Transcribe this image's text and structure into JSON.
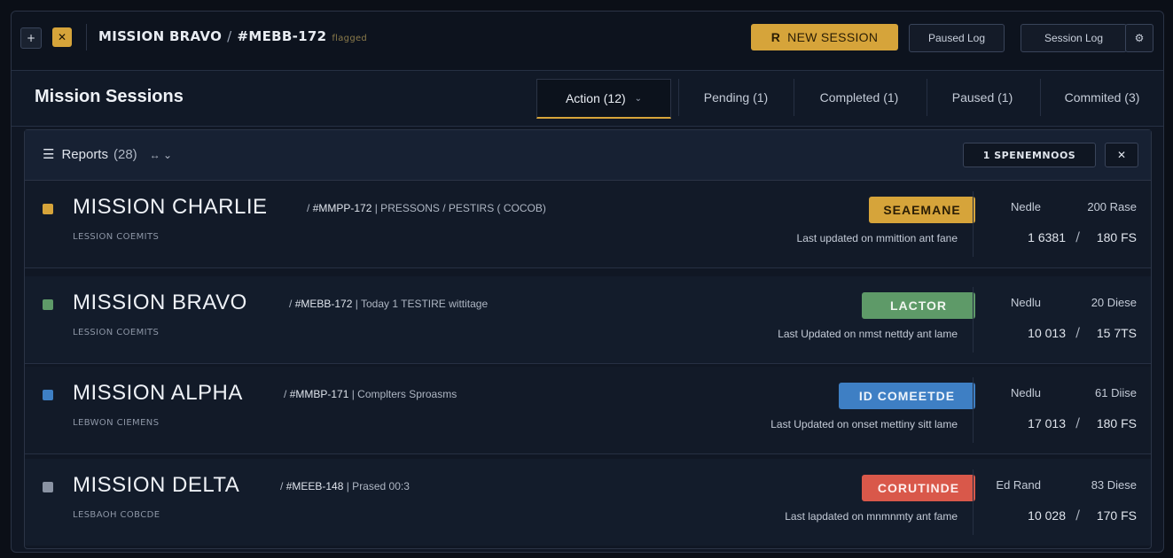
{
  "topbar": {
    "breadcrumb_mission": "MISSION BRAVO",
    "breadcrumb_sep": "/",
    "breadcrumb_id": "#MEBB-172",
    "breadcrumb_tag": "flagged",
    "new_session_icon": "R",
    "new_session_label": "NEW SESSION",
    "paused_log_label": "Paused Log",
    "session_log_label": "Session Log",
    "settings_glyph": "⚙",
    "plus_glyph": "+",
    "x_glyph": "✕",
    "accent": "#d6a43a"
  },
  "header": {
    "title": "Mission Sessions",
    "tabs": [
      {
        "label": "Action (12)",
        "chevron": "⌄"
      },
      {
        "label": "Pending (1)"
      },
      {
        "label": "Completed (1)"
      },
      {
        "label": "Paused (1)"
      },
      {
        "label": "Commited (3)"
      }
    ]
  },
  "panel": {
    "menu_glyph": "☰",
    "title": "Reports",
    "count": "(28)",
    "sort_glyph": "↔ ⌄",
    "filter_label": "1 SPENEMNOOS",
    "close_glyph": "✕"
  },
  "rows": [
    {
      "name": "MISSION CHARLIE",
      "sep": "/",
      "id": "#MMPP-172",
      "detail": "| PRESSONS / PESTIRS ( COCOB)",
      "sub": "LESSION COEMITS",
      "badge": "SEAEMANE",
      "badge_color": "#d6a43a",
      "badge_text_color": "#2a1d05",
      "check_color": "#d6a43a",
      "updated": "Last updated on mmittion ant fane",
      "stat_left": "Nedle",
      "stat_right": "200 Rase",
      "num_left": "1 6381",
      "num_sep": "/",
      "num_right": "180 FS"
    },
    {
      "name": "MISSION BRAVO",
      "sep": "/",
      "id": "#MEBB-172",
      "detail": "| Today   1 TESTIRE wittitage",
      "sub": "LESSION COEMITS",
      "badge": "LACTOR",
      "badge_color": "#5e9a68",
      "badge_text_color": "#f0f6ef",
      "check_color": "#5e9a68",
      "updated": "Last Updated on nmst nettdy ant lame",
      "stat_left": "Nedlu",
      "stat_right": "20 Diese",
      "num_left": "10 013",
      "num_sep": "/",
      "num_right": "15 7TS"
    },
    {
      "name": "MISSION ALPHA",
      "sep": "/",
      "id": "#MMBP-171",
      "detail": "| Complters Sproasms",
      "sub": "LEBWON CIEMENS",
      "badge": "ID COMEETDE",
      "badge_color": "#3e7fc4",
      "badge_text_color": "#eef4fb",
      "check_color": "#3e7fc4",
      "updated": "Last Updated on onset mettiny sitt lame",
      "stat_left": "Nedlu",
      "stat_right": "61 Diise",
      "num_left": "17 013",
      "num_sep": "/",
      "num_right": "180 FS"
    },
    {
      "name": "MISSION DELTA",
      "sep": "/",
      "id": "#MEEB-148",
      "detail": "| Prased 00:3",
      "sub": "LESBAOH COBCDE",
      "badge": "CORUTINDE",
      "badge_color": "#d9584a",
      "badge_text_color": "#fdeeed",
      "check_color": "#8a93a3",
      "updated": "Last lapdated on mnmnmty ant fame",
      "stat_left": "Ed Rand",
      "stat_right": "83 Diese",
      "num_left": "10 028",
      "num_sep": "/",
      "num_right": "170 FS"
    }
  ]
}
